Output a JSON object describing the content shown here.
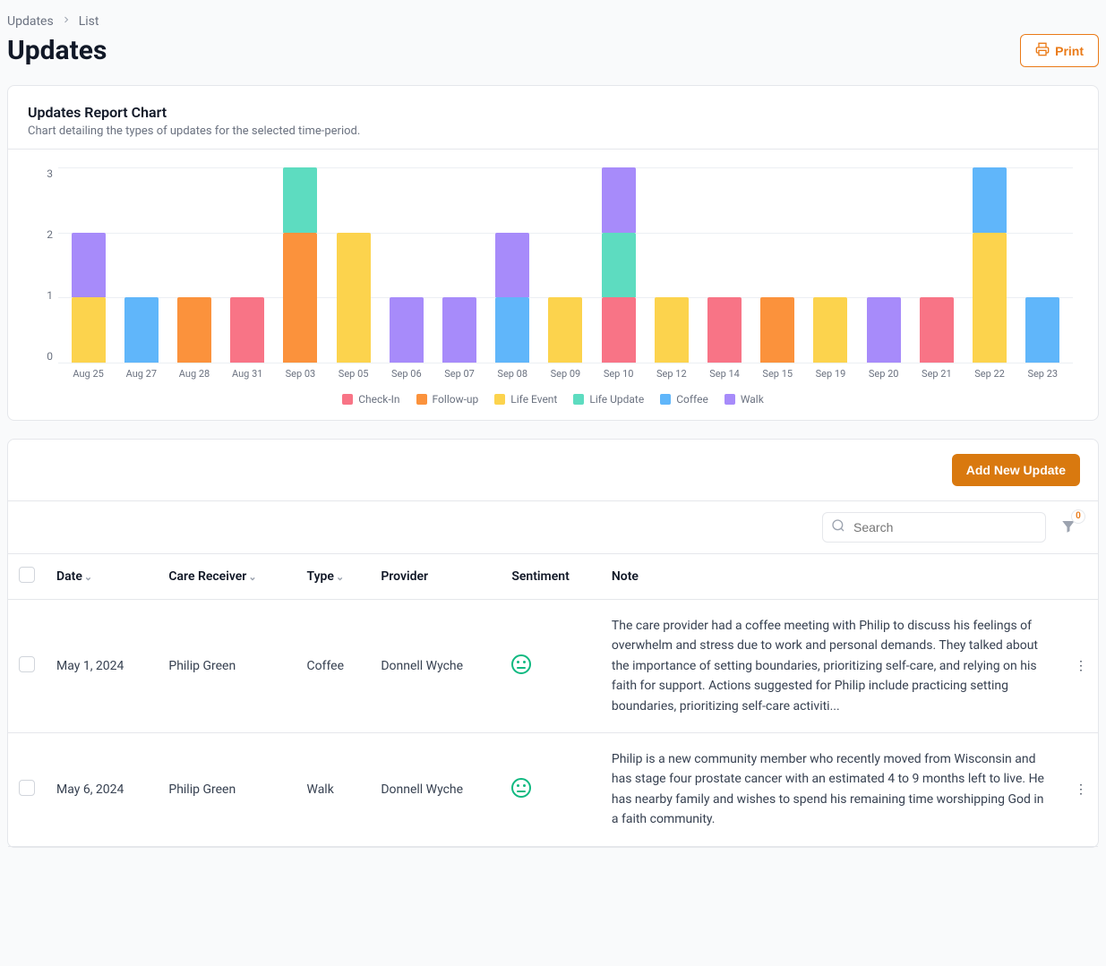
{
  "breadcrumb": {
    "root": "Updates",
    "leaf": "List"
  },
  "page_title": "Updates",
  "print_label": "Print",
  "chart_card": {
    "title": "Updates Report Chart",
    "subtitle": "Chart detailing the types of updates for the selected time-period."
  },
  "chart_data": {
    "type": "bar",
    "title": "Updates Report Chart",
    "xlabel": "",
    "ylabel": "",
    "ylim": [
      0,
      3
    ],
    "categories": [
      "Aug 25",
      "Aug 27",
      "Aug 28",
      "Aug 31",
      "Sep 03",
      "Sep 05",
      "Sep 06",
      "Sep 07",
      "Sep 08",
      "Sep 09",
      "Sep 10",
      "Sep 12",
      "Sep 14",
      "Sep 15",
      "Sep 19",
      "Sep 20",
      "Sep 21",
      "Sep 22",
      "Sep 23"
    ],
    "series": [
      {
        "name": "Check-In",
        "color": "#f87486",
        "values": [
          0,
          0,
          0,
          1,
          0,
          0,
          0,
          0,
          0,
          0,
          1,
          0,
          1,
          0,
          0,
          0,
          1,
          0,
          0
        ]
      },
      {
        "name": "Follow-up",
        "color": "#fb923c",
        "values": [
          0,
          0,
          1,
          0,
          2,
          0,
          0,
          0,
          0,
          0,
          0,
          0,
          0,
          1,
          0,
          0,
          0,
          0,
          0
        ]
      },
      {
        "name": "Life Event",
        "color": "#fcd34d",
        "values": [
          1,
          0,
          0,
          0,
          0,
          2,
          0,
          0,
          0,
          1,
          0,
          1,
          0,
          0,
          1,
          0,
          0,
          2,
          0
        ]
      },
      {
        "name": "Life Update",
        "color": "#5ddcc0",
        "values": [
          0,
          0,
          0,
          0,
          1,
          0,
          0,
          0,
          0,
          0,
          1,
          0,
          0,
          0,
          0,
          0,
          0,
          0,
          0
        ]
      },
      {
        "name": "Coffee",
        "color": "#60b6fa",
        "values": [
          0,
          1,
          0,
          0,
          0,
          0,
          0,
          0,
          1,
          0,
          0,
          0,
          0,
          0,
          0,
          0,
          0,
          1,
          1
        ]
      },
      {
        "name": "Walk",
        "color": "#a78bfa",
        "values": [
          1,
          0,
          0,
          0,
          0,
          0,
          1,
          1,
          1,
          0,
          1,
          0,
          0,
          0,
          0,
          1,
          0,
          0,
          0
        ]
      }
    ]
  },
  "table": {
    "add_label": "Add New Update",
    "search_placeholder": "Search",
    "filter_count": "0",
    "columns": {
      "date": "Date",
      "receiver": "Care Receiver",
      "type": "Type",
      "provider": "Provider",
      "sentiment": "Sentiment",
      "note": "Note"
    },
    "rows": [
      {
        "date": "May 1, 2024",
        "receiver": "Philip Green",
        "type": "Coffee",
        "provider": "Donnell Wyche",
        "note": "The care provider had a coffee meeting with Philip to discuss his feelings of overwhelm and stress due to work and personal demands. They talked about the importance of setting boundaries, prioritizing self-care, and relying on his faith for support. Actions suggested for Philip include practicing setting boundaries, prioritizing self-care activiti..."
      },
      {
        "date": "May 6, 2024",
        "receiver": "Philip Green",
        "type": "Walk",
        "provider": "Donnell Wyche",
        "note": "Philip is a new community member who recently moved from Wisconsin and has stage four prostate cancer with an estimated 4 to 9 months left to live. He has nearby family and wishes to spend his remaining time worshipping God in a faith community."
      }
    ]
  }
}
